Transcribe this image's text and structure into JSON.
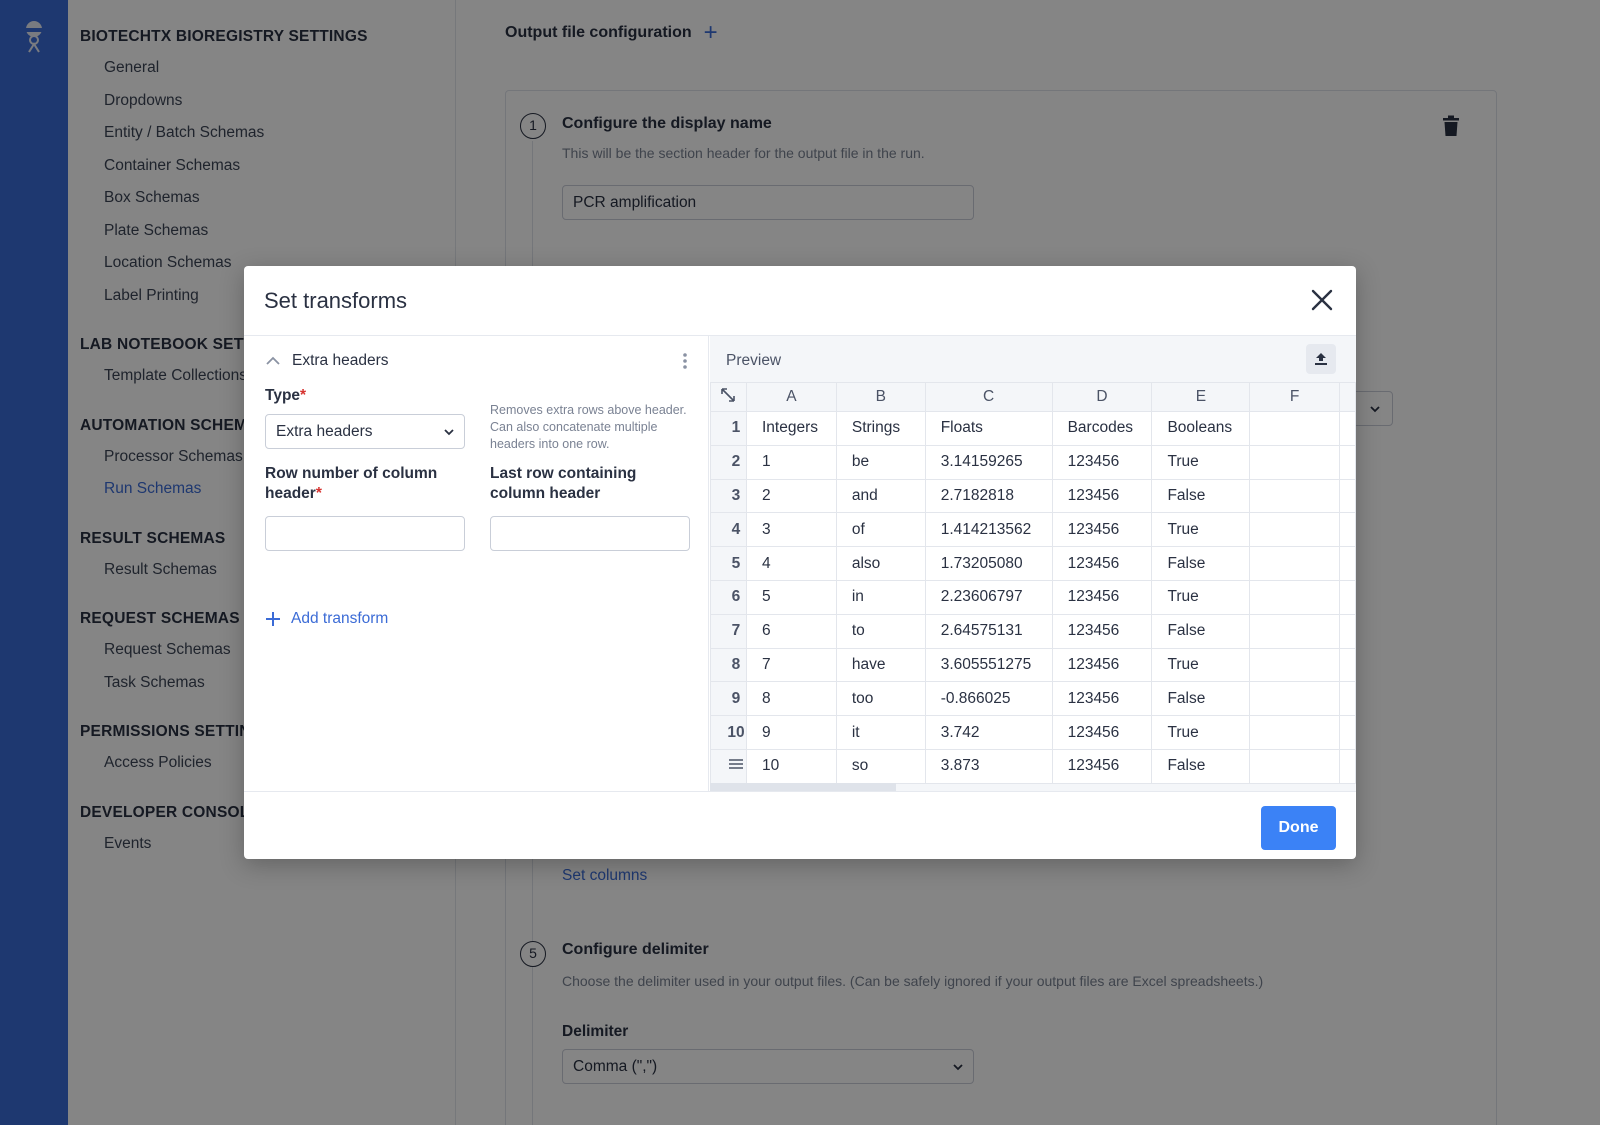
{
  "nav": {
    "sections": [
      {
        "heading": "BIOTECHTX BIOREGISTRY SETTINGS",
        "items": [
          "General",
          "Dropdowns",
          "Entity / Batch Schemas",
          "Container Schemas",
          "Box Schemas",
          "Plate Schemas",
          "Location Schemas",
          "Label Printing"
        ]
      },
      {
        "heading": "LAB NOTEBOOK SETTINGS",
        "items": [
          "Template Collections"
        ]
      },
      {
        "heading": "AUTOMATION SCHEMAS",
        "items": [
          "Processor Schemas",
          "Run Schemas"
        ]
      },
      {
        "heading": "RESULT SCHEMAS",
        "items": [
          "Result Schemas"
        ]
      },
      {
        "heading": "REQUEST SCHEMAS",
        "items": [
          "Request Schemas",
          "Task Schemas"
        ]
      },
      {
        "heading": "PERMISSIONS SETTINGS",
        "items": [
          "Access Policies"
        ]
      },
      {
        "heading": "DEVELOPER CONSOLE",
        "items": [
          "Events"
        ]
      }
    ],
    "active_item": "Run Schemas"
  },
  "main": {
    "title": "Output file configuration",
    "step1": {
      "number": "1",
      "title": "Configure the display name",
      "desc": "This will be the section header for the output file in the run.",
      "value": "PCR amplification"
    },
    "set_columns_link": "Set columns",
    "step5": {
      "number": "5",
      "title": "Configure delimiter",
      "desc": "Choose the delimiter used in your output files. (Can be safely ignored if your output files are Excel spreadsheets.)",
      "delimiter_label": "Delimiter",
      "delimiter_value": "Comma (\",\")"
    }
  },
  "modal": {
    "title": "Set transforms",
    "accordion_title": "Extra headers",
    "type_label": "Type",
    "type_value": "Extra headers",
    "helper": "Removes extra rows above header. Can also concatenate multiple headers into one row.",
    "row_number_label": "Row number of column header",
    "last_row_label": "Last row containing column header",
    "row_number_value": "",
    "last_row_value": "",
    "add_transform": "Add transform",
    "preview_label": "Preview",
    "done": "Done"
  },
  "preview": {
    "columns": [
      "A",
      "B",
      "C",
      "D",
      "E",
      "F"
    ],
    "row_labels": [
      "1",
      "2",
      "3",
      "4",
      "5",
      "6",
      "7",
      "8",
      "9",
      "10"
    ],
    "rows": [
      [
        "Integers",
        "Strings",
        "Floats",
        "Barcodes",
        "Booleans",
        ""
      ],
      [
        "1",
        "be",
        "3.14159265",
        "123456",
        "True",
        ""
      ],
      [
        "2",
        "and",
        "2.7182818",
        "123456",
        "False",
        ""
      ],
      [
        "3",
        "of",
        "1.414213562",
        "123456",
        "True",
        ""
      ],
      [
        "4",
        "also",
        "1.73205080",
        "123456",
        "False",
        ""
      ],
      [
        "5",
        "in",
        "2.23606797",
        "123456",
        "True",
        ""
      ],
      [
        "6",
        "to",
        "2.64575131",
        "123456",
        "False",
        ""
      ],
      [
        "7",
        "have",
        "3.605551275",
        "123456",
        "True",
        ""
      ],
      [
        "8",
        "too",
        "-0.866025",
        "123456",
        "False",
        ""
      ],
      [
        "9",
        "it",
        "3.742",
        "123456",
        "True",
        ""
      ],
      [
        "10",
        "so",
        "3.873",
        "123456",
        "False",
        ""
      ]
    ]
  },
  "colors": {
    "brand": "#3b6bd6",
    "primary_button": "#3b82f6",
    "required": "#d6322f"
  }
}
